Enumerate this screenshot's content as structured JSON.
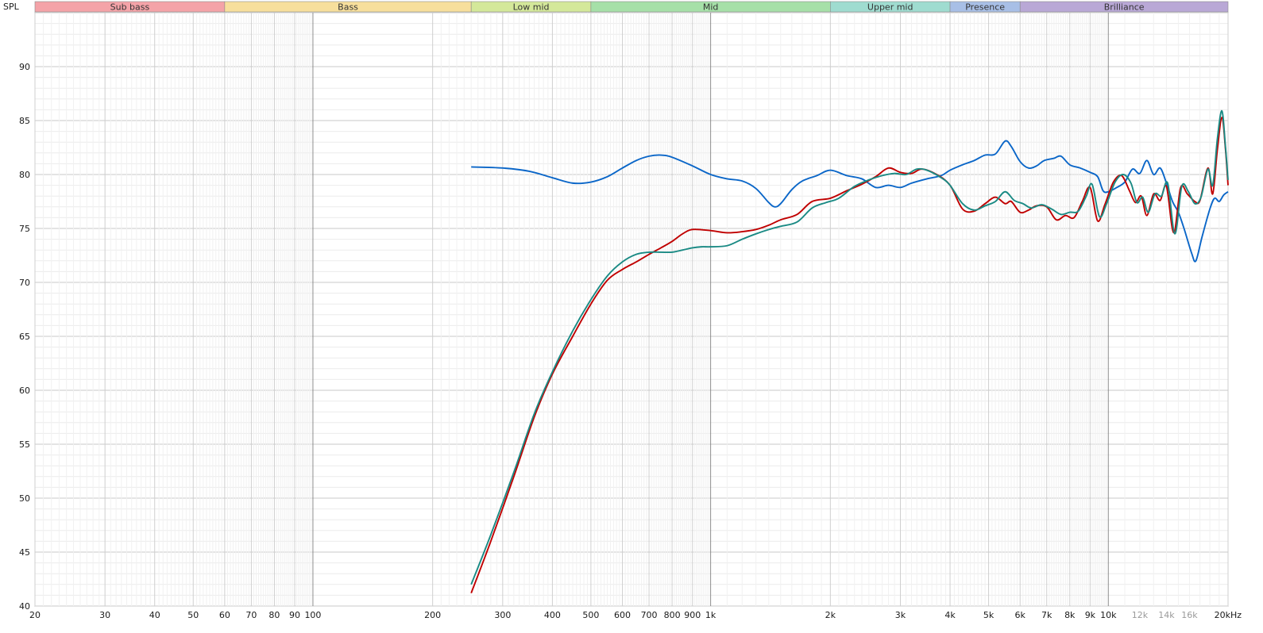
{
  "chart_data": {
    "type": "line",
    "ylabel": "SPL",
    "x_unit": "kHz",
    "x_scale": "log",
    "xlim": [
      20,
      20000
    ],
    "ylim": [
      40,
      95
    ],
    "grid": true,
    "bands": [
      {
        "name": "Sub bass",
        "range": [
          20,
          60
        ],
        "color": "#f4a3a8"
      },
      {
        "name": "Bass",
        "range": [
          60,
          250
        ],
        "color": "#f7df9c"
      },
      {
        "name": "Low mid",
        "range": [
          250,
          500
        ],
        "color": "#d4e89a"
      },
      {
        "name": "Mid",
        "range": [
          500,
          2000
        ],
        "color": "#a6e0a8"
      },
      {
        "name": "Upper mid",
        "range": [
          2000,
          4000
        ],
        "color": "#9fdcd0"
      },
      {
        "name": "Presence",
        "range": [
          4000,
          6000
        ],
        "color": "#a8bfe6"
      },
      {
        "name": "Brilliance",
        "range": [
          6000,
          20000
        ],
        "color": "#b9a8d6"
      }
    ],
    "y_ticks": [
      40,
      45,
      50,
      55,
      60,
      65,
      70,
      75,
      80,
      85,
      90
    ],
    "x_ticks": [
      {
        "value": 20,
        "label": "20"
      },
      {
        "value": 30,
        "label": "30"
      },
      {
        "value": 40,
        "label": "40"
      },
      {
        "value": 50,
        "label": "50"
      },
      {
        "value": 60,
        "label": "60"
      },
      {
        "value": 70,
        "label": "70"
      },
      {
        "value": 80,
        "label": "80"
      },
      {
        "value": 90,
        "label": "90"
      },
      {
        "value": 100,
        "label": "100"
      },
      {
        "value": 200,
        "label": "200"
      },
      {
        "value": 300,
        "label": "300"
      },
      {
        "value": 400,
        "label": "400"
      },
      {
        "value": 500,
        "label": "500"
      },
      {
        "value": 600,
        "label": "600"
      },
      {
        "value": 700,
        "label": "700"
      },
      {
        "value": 800,
        "label": "800"
      },
      {
        "value": 900,
        "label": "900"
      },
      {
        "value": 1000,
        "label": "1k"
      },
      {
        "value": 2000,
        "label": "2k"
      },
      {
        "value": 3000,
        "label": "3k"
      },
      {
        "value": 4000,
        "label": "4k"
      },
      {
        "value": 5000,
        "label": "5k"
      },
      {
        "value": 6000,
        "label": "6k"
      },
      {
        "value": 7000,
        "label": "7k"
      },
      {
        "value": 8000,
        "label": "8k"
      },
      {
        "value": 9000,
        "label": "9k"
      },
      {
        "value": 10000,
        "label": "10k"
      },
      {
        "value": 12000,
        "label": "12k",
        "dim": true
      },
      {
        "value": 14000,
        "label": "14k",
        "dim": true
      },
      {
        "value": 16000,
        "label": "16k",
        "dim": true
      },
      {
        "value": 20000,
        "label": "20kHz"
      }
    ],
    "series": [
      {
        "color": "#0a66c8",
        "points": [
          [
            250,
            80.7
          ],
          [
            300,
            80.6
          ],
          [
            350,
            80.3
          ],
          [
            400,
            79.7
          ],
          [
            450,
            79.2
          ],
          [
            500,
            79.3
          ],
          [
            550,
            79.8
          ],
          [
            600,
            80.6
          ],
          [
            650,
            81.3
          ],
          [
            700,
            81.7
          ],
          [
            750,
            81.8
          ],
          [
            800,
            81.6
          ],
          [
            900,
            80.8
          ],
          [
            1000,
            80.0
          ],
          [
            1100,
            79.6
          ],
          [
            1200,
            79.4
          ],
          [
            1300,
            78.7
          ],
          [
            1400,
            77.4
          ],
          [
            1450,
            77.0
          ],
          [
            1500,
            77.3
          ],
          [
            1600,
            78.6
          ],
          [
            1700,
            79.4
          ],
          [
            1850,
            79.9
          ],
          [
            2000,
            80.4
          ],
          [
            2200,
            79.9
          ],
          [
            2400,
            79.6
          ],
          [
            2600,
            78.8
          ],
          [
            2800,
            79.0
          ],
          [
            3000,
            78.8
          ],
          [
            3200,
            79.2
          ],
          [
            3500,
            79.6
          ],
          [
            3800,
            79.9
          ],
          [
            4000,
            80.4
          ],
          [
            4300,
            80.9
          ],
          [
            4600,
            81.3
          ],
          [
            4900,
            81.8
          ],
          [
            5200,
            81.9
          ],
          [
            5500,
            83.1
          ],
          [
            5700,
            82.6
          ],
          [
            6000,
            81.2
          ],
          [
            6300,
            80.6
          ],
          [
            6600,
            80.8
          ],
          [
            6900,
            81.3
          ],
          [
            7300,
            81.5
          ],
          [
            7600,
            81.7
          ],
          [
            8000,
            80.9
          ],
          [
            8500,
            80.6
          ],
          [
            9000,
            80.2
          ],
          [
            9400,
            79.8
          ],
          [
            9700,
            78.5
          ],
          [
            10000,
            78.4
          ],
          [
            10500,
            78.8
          ],
          [
            11000,
            79.3
          ],
          [
            11500,
            80.5
          ],
          [
            12000,
            80.1
          ],
          [
            12500,
            81.3
          ],
          [
            13000,
            80.0
          ],
          [
            13500,
            80.6
          ],
          [
            14000,
            79.2
          ],
          [
            14500,
            77.5
          ],
          [
            15000,
            76.5
          ],
          [
            15500,
            75.0
          ],
          [
            16200,
            72.7
          ],
          [
            16600,
            72.0
          ],
          [
            17200,
            74.2
          ],
          [
            18000,
            76.8
          ],
          [
            18500,
            77.8
          ],
          [
            19000,
            77.5
          ],
          [
            19500,
            78.1
          ],
          [
            20000,
            78.4
          ]
        ]
      },
      {
        "color": "#c00000",
        "points": [
          [
            250,
            41.2
          ],
          [
            280,
            46.0
          ],
          [
            320,
            52.0
          ],
          [
            360,
            57.5
          ],
          [
            400,
            61.5
          ],
          [
            450,
            65.0
          ],
          [
            500,
            68.0
          ],
          [
            550,
            70.2
          ],
          [
            600,
            71.2
          ],
          [
            650,
            71.9
          ],
          [
            700,
            72.6
          ],
          [
            750,
            73.2
          ],
          [
            800,
            73.8
          ],
          [
            850,
            74.5
          ],
          [
            900,
            74.9
          ],
          [
            1000,
            74.8
          ],
          [
            1100,
            74.6
          ],
          [
            1200,
            74.7
          ],
          [
            1300,
            74.9
          ],
          [
            1400,
            75.3
          ],
          [
            1500,
            75.8
          ],
          [
            1650,
            76.3
          ],
          [
            1800,
            77.5
          ],
          [
            2000,
            77.8
          ],
          [
            2200,
            78.5
          ],
          [
            2400,
            79.1
          ],
          [
            2600,
            79.8
          ],
          [
            2800,
            80.6
          ],
          [
            3000,
            80.2
          ],
          [
            3200,
            80.1
          ],
          [
            3400,
            80.5
          ],
          [
            3700,
            80.0
          ],
          [
            4000,
            79.0
          ],
          [
            4300,
            76.8
          ],
          [
            4600,
            76.6
          ],
          [
            4900,
            77.3
          ],
          [
            5200,
            77.9
          ],
          [
            5500,
            77.3
          ],
          [
            5700,
            77.5
          ],
          [
            6000,
            76.5
          ],
          [
            6300,
            76.7
          ],
          [
            6600,
            77.1
          ],
          [
            7000,
            77.0
          ],
          [
            7400,
            75.8
          ],
          [
            7800,
            76.2
          ],
          [
            8200,
            76.0
          ],
          [
            8600,
            77.5
          ],
          [
            9000,
            78.8
          ],
          [
            9400,
            75.7
          ],
          [
            9800,
            77.2
          ],
          [
            10300,
            79.3
          ],
          [
            10800,
            79.9
          ],
          [
            11300,
            78.5
          ],
          [
            11700,
            77.4
          ],
          [
            12100,
            78.0
          ],
          [
            12500,
            76.2
          ],
          [
            13000,
            78.2
          ],
          [
            13500,
            77.6
          ],
          [
            14000,
            78.9
          ],
          [
            14600,
            74.6
          ],
          [
            15200,
            78.8
          ],
          [
            15800,
            78.2
          ],
          [
            16500,
            77.5
          ],
          [
            17000,
            77.6
          ],
          [
            17800,
            80.6
          ],
          [
            18300,
            78.2
          ],
          [
            18800,
            82.3
          ],
          [
            19300,
            85.3
          ],
          [
            19700,
            82.4
          ],
          [
            20000,
            79.0
          ]
        ]
      },
      {
        "color": "#1a8a84",
        "points": [
          [
            250,
            42.0
          ],
          [
            280,
            46.6
          ],
          [
            320,
            52.4
          ],
          [
            360,
            57.8
          ],
          [
            400,
            61.7
          ],
          [
            450,
            65.5
          ],
          [
            500,
            68.4
          ],
          [
            550,
            70.6
          ],
          [
            600,
            71.9
          ],
          [
            650,
            72.6
          ],
          [
            700,
            72.8
          ],
          [
            750,
            72.8
          ],
          [
            800,
            72.8
          ],
          [
            850,
            73.0
          ],
          [
            900,
            73.2
          ],
          [
            950,
            73.3
          ],
          [
            1000,
            73.3
          ],
          [
            1100,
            73.4
          ],
          [
            1200,
            74.0
          ],
          [
            1300,
            74.5
          ],
          [
            1400,
            74.9
          ],
          [
            1500,
            75.2
          ],
          [
            1650,
            75.6
          ],
          [
            1800,
            76.9
          ],
          [
            1950,
            77.4
          ],
          [
            2100,
            77.8
          ],
          [
            2300,
            78.9
          ],
          [
            2500,
            79.5
          ],
          [
            2700,
            79.9
          ],
          [
            2900,
            80.1
          ],
          [
            3100,
            80.0
          ],
          [
            3300,
            80.5
          ],
          [
            3500,
            80.4
          ],
          [
            3800,
            79.7
          ],
          [
            4000,
            79.0
          ],
          [
            4300,
            77.3
          ],
          [
            4600,
            76.7
          ],
          [
            4900,
            77.1
          ],
          [
            5200,
            77.5
          ],
          [
            5500,
            78.4
          ],
          [
            5800,
            77.6
          ],
          [
            6100,
            77.3
          ],
          [
            6400,
            76.9
          ],
          [
            6800,
            77.2
          ],
          [
            7200,
            76.8
          ],
          [
            7600,
            76.3
          ],
          [
            8000,
            76.5
          ],
          [
            8400,
            76.6
          ],
          [
            8800,
            78.0
          ],
          [
            9100,
            79.1
          ],
          [
            9500,
            76.1
          ],
          [
            9900,
            77.3
          ],
          [
            10400,
            79.3
          ],
          [
            10900,
            80.0
          ],
          [
            11400,
            79.2
          ],
          [
            11800,
            77.4
          ],
          [
            12200,
            77.9
          ],
          [
            12600,
            76.5
          ],
          [
            13100,
            78.2
          ],
          [
            13600,
            78.0
          ],
          [
            14100,
            79.2
          ],
          [
            14700,
            74.5
          ],
          [
            15300,
            78.9
          ],
          [
            15900,
            78.4
          ],
          [
            16500,
            77.3
          ],
          [
            17100,
            77.9
          ],
          [
            17800,
            80.5
          ],
          [
            18300,
            79.0
          ],
          [
            18800,
            83.3
          ],
          [
            19300,
            85.9
          ],
          [
            19700,
            82.6
          ],
          [
            20000,
            79.5
          ]
        ]
      }
    ]
  }
}
